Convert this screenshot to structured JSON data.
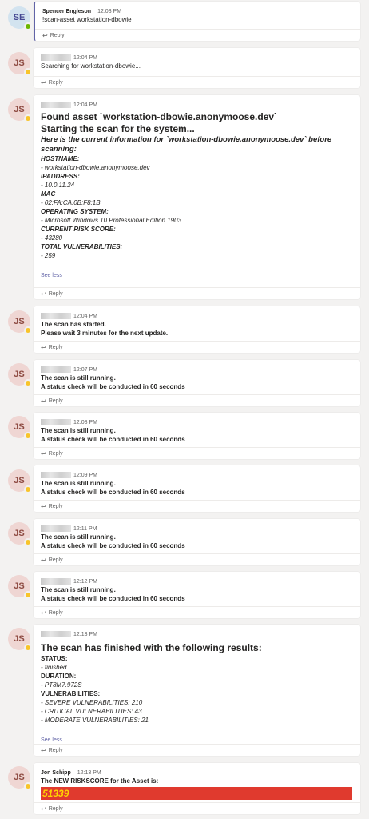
{
  "reply_label": "Reply",
  "see_less_label": "See less",
  "messages": [
    {
      "initials": "SE",
      "author": "Spencer Engleson",
      "time": "12:03 PM",
      "text": "!scan-asset workstation-dbowie"
    },
    {
      "initials": "JS",
      "time": "12:04 PM",
      "text": "Searching for workstation-dbowie..."
    },
    {
      "initials": "JS",
      "time": "12:04 PM",
      "found": "Found asset `workstation-dbowie.anonymoose.dev`",
      "starting": "Starting the scan for the system...",
      "intro": "Here is the current information for `workstation-dbowie.anonymoose.dev` before scanning:",
      "fields": [
        {
          "label": "HOSTNAME:",
          "value": "- workstation-dbowie.anonymoose.dev"
        },
        {
          "label": "IPADDRESS:",
          "value": "- 10.0.11.24"
        },
        {
          "label": "MAC",
          "value": "- 02:FA:CA:0B:F8:1B"
        },
        {
          "label": "OPERATING SYSTEM:",
          "value": "- Microsoft Windows 10 Professional Edition 1903"
        },
        {
          "label": "CURRENT RISK SCORE:",
          "value": "- 43280"
        },
        {
          "label": "TOTAL VULNERABILITIES:",
          "value": "- 259"
        }
      ]
    },
    {
      "initials": "JS",
      "time": "12:04 PM",
      "line1": "The scan has started.",
      "line2": "Please wait 3 minutes for the next update."
    },
    {
      "initials": "JS",
      "time": "12:07 PM",
      "line1": "The scan is still running.",
      "line2": "A status check will be conducted in 60 seconds"
    },
    {
      "initials": "JS",
      "time": "12:08 PM",
      "line1": "The scan is still running.",
      "line2": "A status check will be conducted in 60 seconds"
    },
    {
      "initials": "JS",
      "time": "12:09 PM",
      "line1": "The scan is still running.",
      "line2": "A status check will be conducted in 60 seconds"
    },
    {
      "initials": "JS",
      "time": "12:11 PM",
      "line1": "The scan is still running.",
      "line2": "A status check will be conducted in 60 seconds"
    },
    {
      "initials": "JS",
      "time": "12:12 PM",
      "line1": "The scan is still running.",
      "line2": "A status check will be conducted in 60 seconds"
    },
    {
      "initials": "JS",
      "time": "12:13 PM",
      "heading": "The scan has finished with the following results:",
      "status_label": "STATUS:",
      "status_value": "- finished",
      "duration_label": "DURATION:",
      "duration_value": "- PT8M7.972S",
      "vuln_label": "VULNERABILITIES:",
      "vulns": [
        "- SEVERE VULNERABILITIES: 210",
        "- CRITICAL VULNERABILITIES: 43",
        "- MODERATE VULNERABILITIES: 21"
      ]
    },
    {
      "initials": "JS",
      "author": "Jon Schipp",
      "time": "12:13 PM",
      "line1": "The NEW RISKSCORE for the Asset is:",
      "risk": "51339"
    }
  ]
}
